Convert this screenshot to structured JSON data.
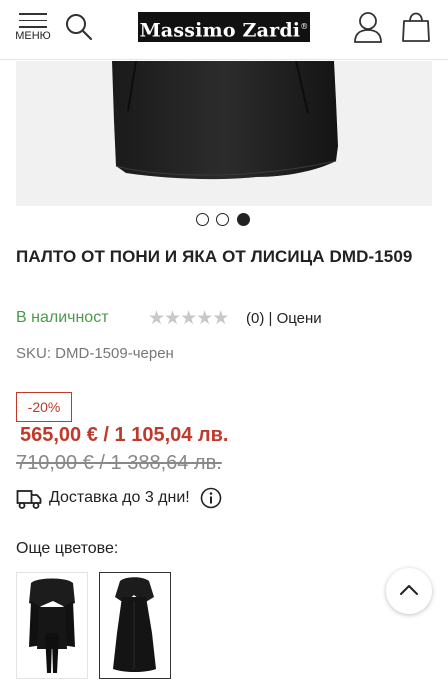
{
  "header": {
    "menu_label": "МЕНЮ",
    "logo_text": "Massimo Zardi",
    "logo_mark": "®",
    "menu_icon": "hamburger-icon",
    "search_icon": "search-icon",
    "account_icon": "user-icon",
    "cart_icon": "shopping-bag-icon"
  },
  "gallery": {
    "slides": 3,
    "active_slide": 3
  },
  "product": {
    "title": "ПАЛТО ОТ ПОНИ И ЯКА ОТ ЛИСИЦА DMD-1509",
    "stock": "В наличност",
    "rating_stars": 0,
    "rating_max": 5,
    "review_count": "(0)",
    "review_link": "| Оцени",
    "sku": "SKU: DMD-1509-черен",
    "discount": "-20%",
    "price_new": "565,00 € / 1 105,04 лв.",
    "price_old": "710,00 € / 1 388,64 лв.",
    "delivery": "Доставка до 3 дни!",
    "delivery_icon": "truck-icon",
    "info_icon": "info-icon"
  },
  "colors": {
    "label": "Още цветове:"
  },
  "colors_theme": {
    "accent_red": "#c0392b",
    "stock_green": "#4a9a4a"
  },
  "scroll_top_icon": "chevron-up-icon"
}
